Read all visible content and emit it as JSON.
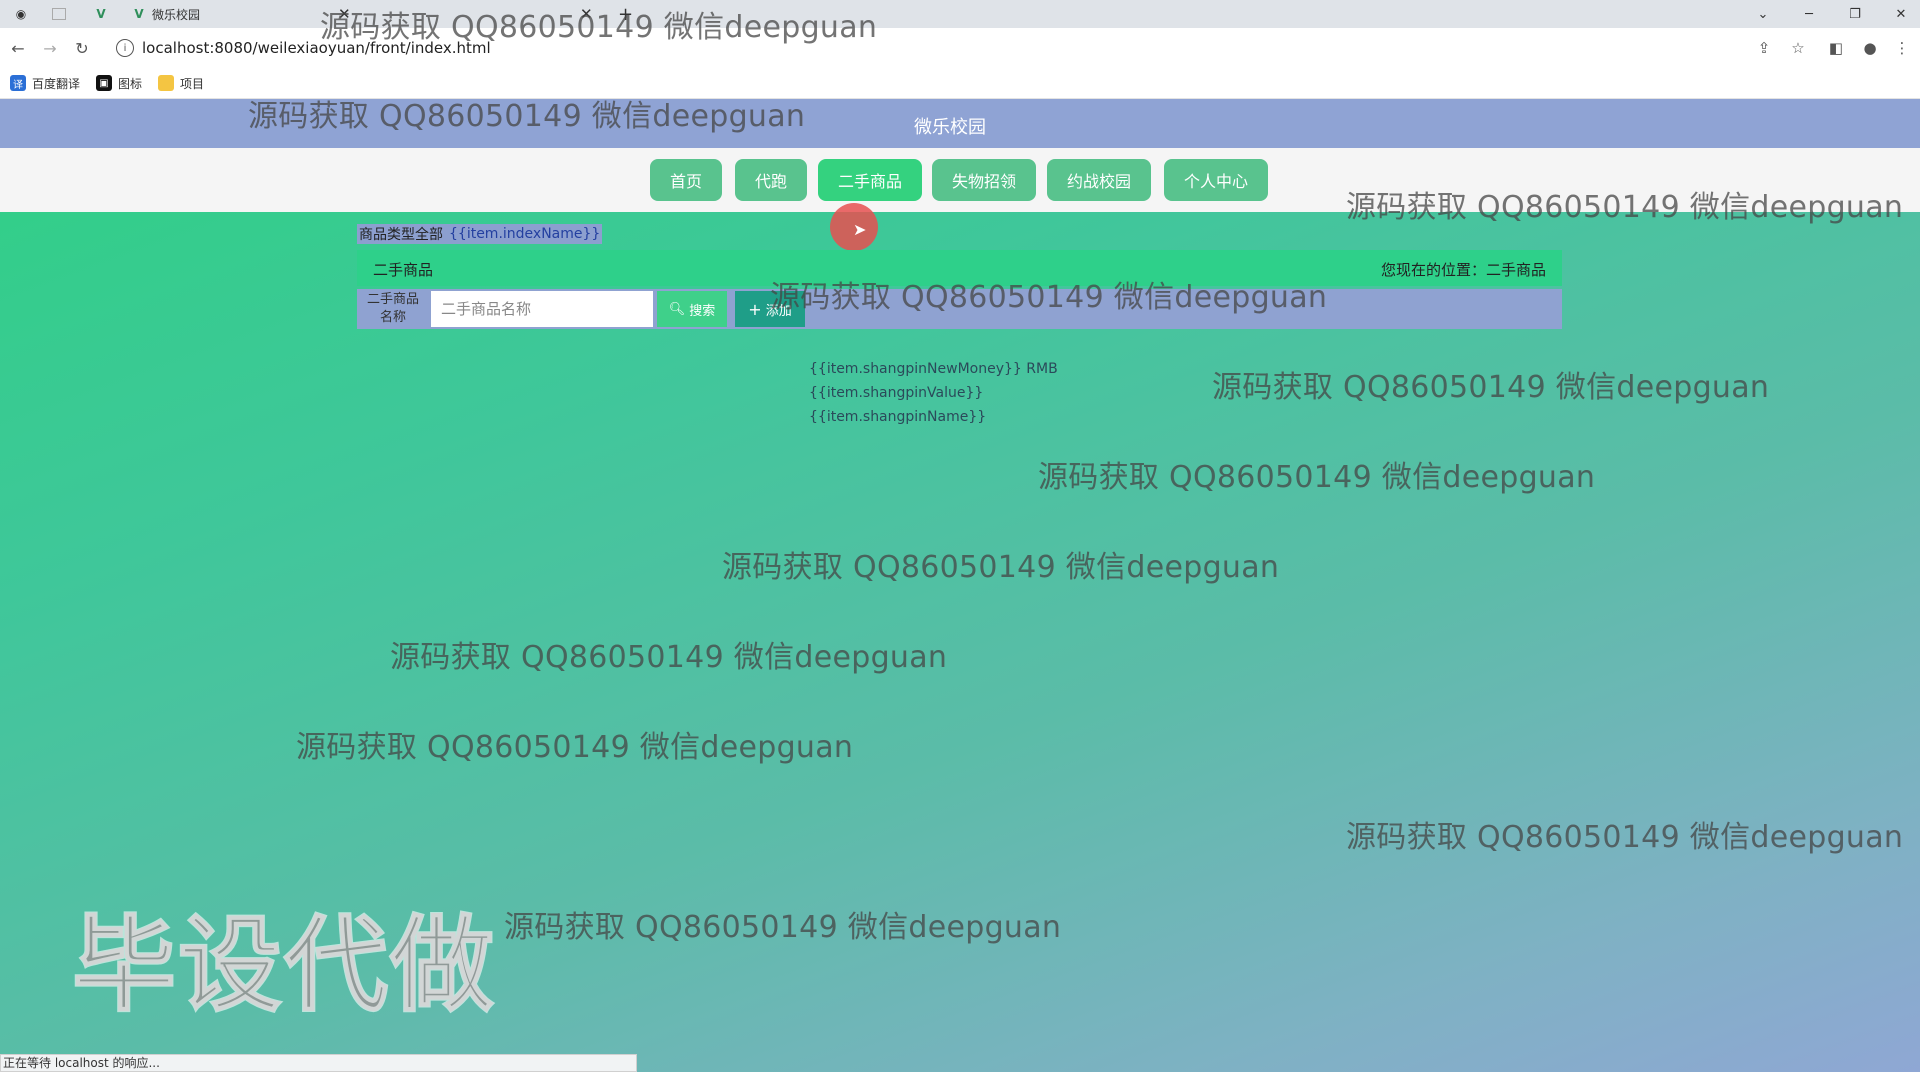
{
  "browser": {
    "tab_title": "微乐校园",
    "tab2_title": "",
    "url": "localhost:8080/weilexiaoyuan/front/index.html",
    "bookmarks": [
      "百度翻译",
      "图标",
      "项目"
    ],
    "status": "正在等待 localhost 的响应..."
  },
  "site": {
    "title": "微乐校园",
    "menu": [
      "首页",
      "代跑",
      "二手商品",
      "失物招领",
      "约战校园",
      "个人中心"
    ],
    "active_menu": "二手商品"
  },
  "category": {
    "label": "商品类型全部",
    "template": "{{item.indexName}}"
  },
  "list": {
    "title": "二手商品",
    "location": "您现在的位置：二手商品"
  },
  "search": {
    "label": "二手商品名称",
    "placeholder": "二手商品名称",
    "search_button": "搜索",
    "add_button": "添加"
  },
  "goods": {
    "price": "{{item.shangpinNewMoney}} RMB",
    "value": "{{item.shangpinValue}}",
    "name": "{{item.shangpinName}}"
  },
  "watermark": {
    "text": "源码获取 QQ86050149 微信deepguan",
    "big": "毕设代做"
  }
}
